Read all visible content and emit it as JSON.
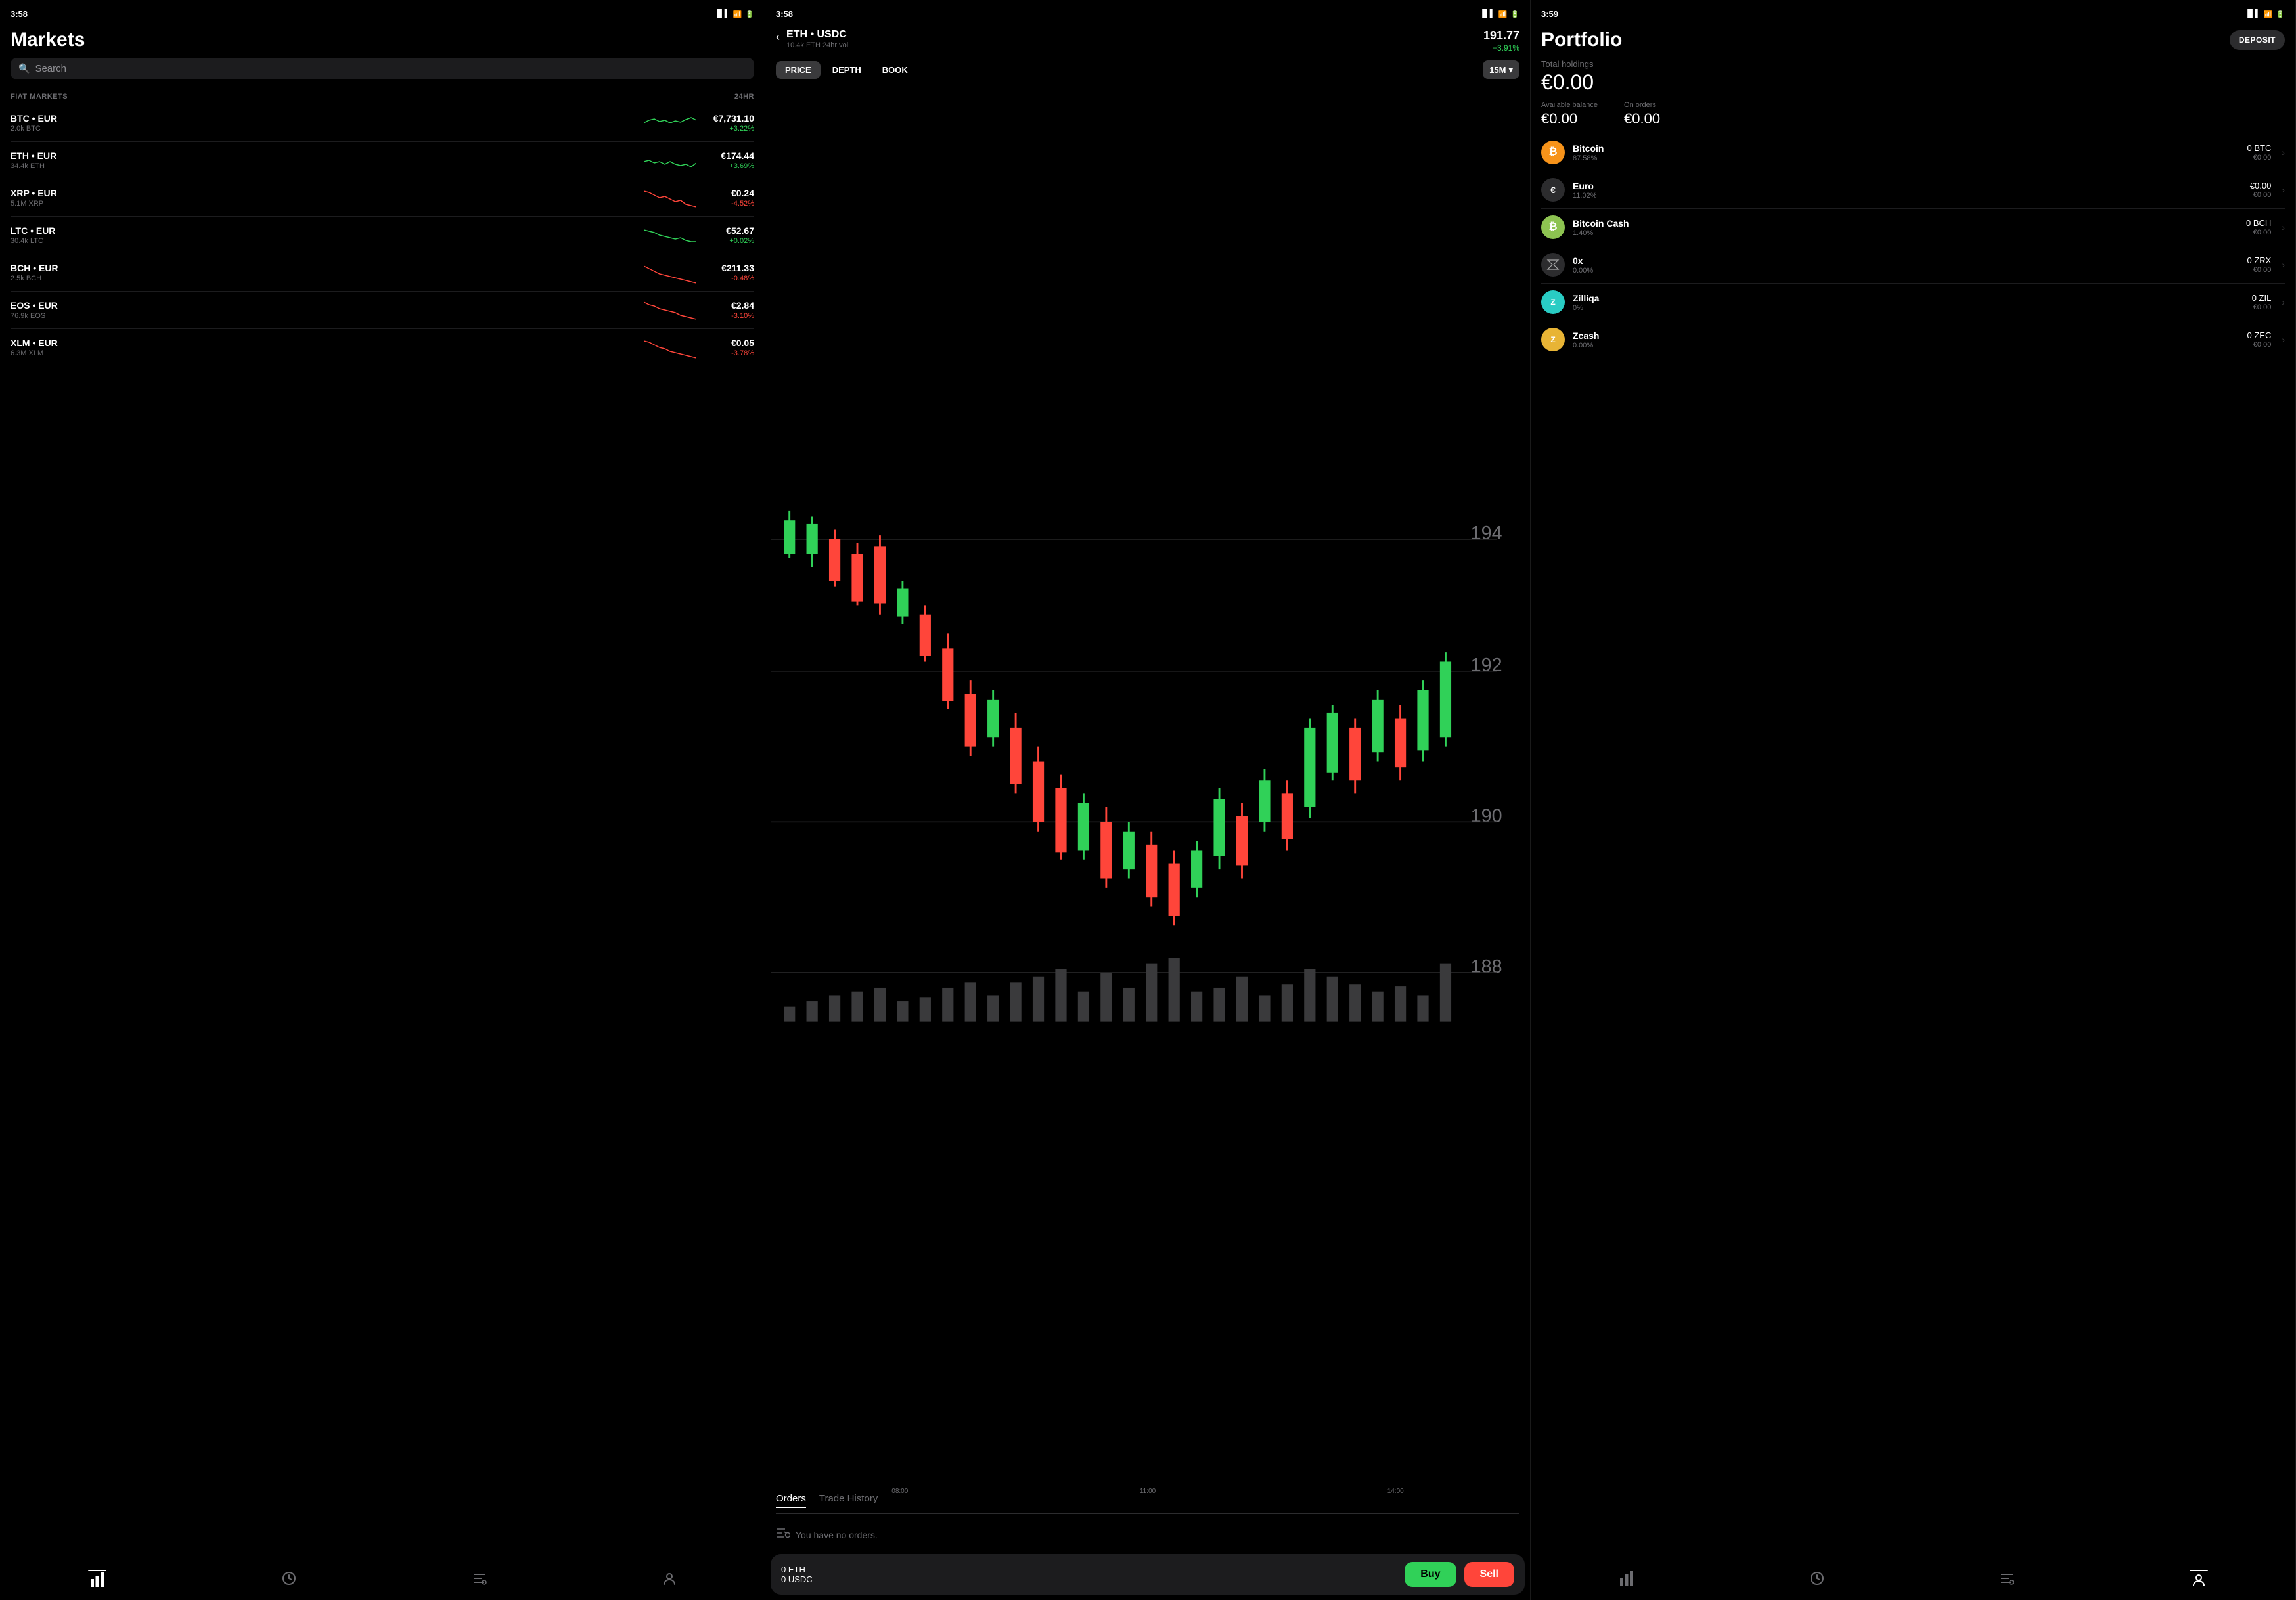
{
  "panels": {
    "markets": {
      "statusTime": "3:58",
      "title": "Markets",
      "search": {
        "placeholder": "Search"
      },
      "sectionLabel": "FIAT MARKETS",
      "sectionRight": "24HR",
      "items": [
        {
          "pair": "BTC • EUR",
          "vol": "2.0k BTC",
          "price": "€7,731.10",
          "change": "+3.22%",
          "positive": true
        },
        {
          "pair": "ETH • EUR",
          "vol": "34.4k ETH",
          "price": "€174.44",
          "change": "+3.69%",
          "positive": true
        },
        {
          "pair": "XRP • EUR",
          "vol": "5.1M XRP",
          "price": "€0.24",
          "change": "-4.52%",
          "positive": false
        },
        {
          "pair": "LTC • EUR",
          "vol": "30.4k LTC",
          "price": "€52.67",
          "change": "+0.02%",
          "positive": true
        },
        {
          "pair": "BCH • EUR",
          "vol": "2.5k BCH",
          "price": "€211.33",
          "change": "-0.48%",
          "positive": false
        },
        {
          "pair": "EOS • EUR",
          "vol": "76.9k EOS",
          "price": "€2.84",
          "change": "-3.10%",
          "positive": false
        },
        {
          "pair": "XLM • EUR",
          "vol": "6.3M XLM",
          "price": "€0.05",
          "change": "-3.78%",
          "positive": false
        }
      ],
      "nav": [
        {
          "icon": "📊",
          "active": true
        },
        {
          "icon": "⏱",
          "active": false
        },
        {
          "icon": "≡",
          "active": false
        },
        {
          "icon": "👤",
          "active": false
        }
      ]
    },
    "chart": {
      "statusTime": "3:58",
      "pair": "ETH • USDC",
      "vol": "10.4k ETH 24hr vol",
      "price": "191.77",
      "change": "+3.91%",
      "tabs": [
        "PRICE",
        "DEPTH",
        "BOOK"
      ],
      "activeTab": "PRICE",
      "timeframe": "15M",
      "yLabels": [
        "194",
        "192",
        "190",
        "188"
      ],
      "xLabels": [
        "08:00",
        "11:00",
        "14:00"
      ],
      "orders": {
        "tabs": [
          "Orders",
          "Trade History"
        ],
        "activeTab": "Orders",
        "emptyText": "You have no orders."
      },
      "tradeBar": {
        "eth": "0 ETH",
        "usdc": "0 USDC",
        "buyLabel": "Buy",
        "sellLabel": "Sell"
      }
    },
    "portfolio": {
      "statusTime": "3:59",
      "title": "Portfolio",
      "depositLabel": "DEPOSIT",
      "totalLabel": "Total holdings",
      "totalValue": "€0.00",
      "availableLabel": "Available balance",
      "availableValue": "€0.00",
      "ordersLabel": "On orders",
      "ordersValue": "€0.00",
      "holdings": [
        {
          "name": "Bitcoin",
          "pct": "87.58%",
          "crypto": "0 BTC",
          "eur": "€0.00",
          "icon": "btc",
          "symbol": "₿"
        },
        {
          "name": "Euro",
          "pct": "11.02%",
          "crypto": "€0.00",
          "eur": "€0.00",
          "icon": "eur",
          "symbol": "€"
        },
        {
          "name": "Bitcoin Cash",
          "pct": "1.40%",
          "crypto": "0 BCH",
          "eur": "€0.00",
          "icon": "bch",
          "symbol": "₿"
        },
        {
          "name": "0x",
          "pct": "0.00%",
          "crypto": "0 ZRX",
          "eur": "€0.00",
          "icon": "zrx",
          "symbol": "✕"
        },
        {
          "name": "Zilliqa",
          "pct": "0%",
          "crypto": "0 ZIL",
          "eur": "€0.00",
          "icon": "zil",
          "symbol": "Z"
        },
        {
          "name": "Zcash",
          "pct": "0.00%",
          "crypto": "0 ZEC",
          "eur": "€0.00",
          "icon": "zec",
          "symbol": "Z"
        }
      ],
      "nav": [
        {
          "icon": "📊",
          "active": false
        },
        {
          "icon": "⏱",
          "active": false
        },
        {
          "icon": "≡",
          "active": false
        },
        {
          "icon": "👤",
          "active": false
        }
      ]
    }
  }
}
